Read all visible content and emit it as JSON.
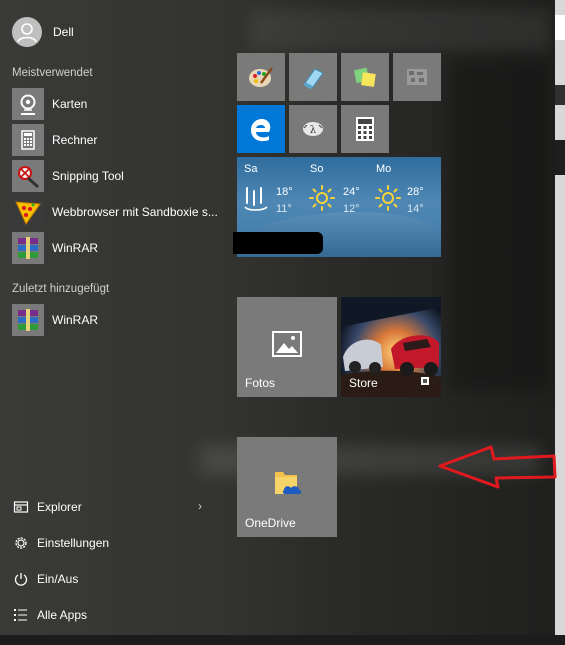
{
  "user": {
    "name": "Dell"
  },
  "sections": {
    "most_used": "Meistverwendet",
    "recently_added": "Zuletzt hinzugefügt"
  },
  "most_used_apps": [
    {
      "label": "Karten",
      "icon": "maps-icon"
    },
    {
      "label": "Rechner",
      "icon": "calculator-icon"
    },
    {
      "label": "Snipping Tool",
      "icon": "snipping-tool-icon"
    },
    {
      "label": "Webbrowser mit Sandboxie s...",
      "icon": "sandboxie-icon"
    },
    {
      "label": "WinRAR",
      "icon": "winrar-icon"
    }
  ],
  "recent_apps": [
    {
      "label": "WinRAR",
      "icon": "winrar-icon"
    }
  ],
  "system": {
    "explorer": "Explorer",
    "settings": "Einstellungen",
    "power": "Ein/Aus",
    "all_apps": "Alle Apps"
  },
  "tiles": {
    "photos_label": "Fotos",
    "store_label": "Store",
    "onedrive_label": "OneDrive",
    "small": [
      "paint-icon",
      "notepad-icon",
      "sticky-notes-icon",
      "minecraft-icon",
      "edge-icon",
      "math-input-icon",
      "calculator-icon"
    ]
  },
  "weather": {
    "days": [
      {
        "day": "Sa",
        "high": "18°",
        "low": "11°",
        "icon": "rain-icon"
      },
      {
        "day": "So",
        "high": "24°",
        "low": "12°",
        "icon": "sun-icon"
      },
      {
        "day": "Mo",
        "high": "28°",
        "low": "14°",
        "icon": "sun-icon"
      }
    ]
  },
  "colors": {
    "accent": "#0078d7",
    "tile_gray": "#7a7a7a",
    "arrow": "#e0191f"
  }
}
